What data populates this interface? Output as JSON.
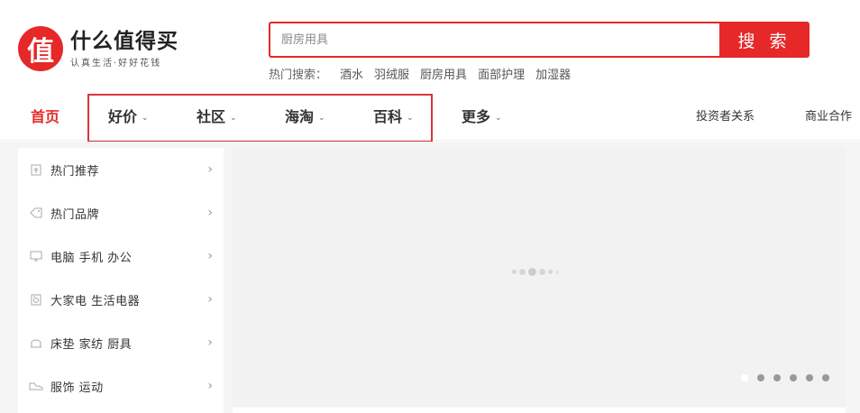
{
  "logo": {
    "badge_char": "值",
    "title": "什么值得买",
    "slogan": "认真生活·好好花钱"
  },
  "search": {
    "placeholder": "厨房用具",
    "button_label": "搜 索"
  },
  "hot_search": {
    "label": "热门搜索：",
    "items": [
      "酒水",
      "羽绒服",
      "厨房用具",
      "面部护理",
      "加湿器"
    ]
  },
  "nav": {
    "home": "首页",
    "items": [
      {
        "label": "好价"
      },
      {
        "label": "社区"
      },
      {
        "label": "海淘"
      },
      {
        "label": "百科"
      },
      {
        "label": "更多"
      }
    ],
    "right": [
      "投资者关系",
      "商业合作"
    ],
    "chevron": "⌄"
  },
  "categories": [
    {
      "label": "热门推荐",
      "icon": "hot-recommend-icon"
    },
    {
      "label": "热门品牌",
      "icon": "tag-icon"
    },
    {
      "label": "电脑  手机  办公",
      "icon": "monitor-icon"
    },
    {
      "label": "大家电  生活电器",
      "icon": "appliance-icon"
    },
    {
      "label": "床垫  家纺  厨具",
      "icon": "home-icon"
    },
    {
      "label": "服饰  运动",
      "icon": "shoe-icon"
    }
  ],
  "carousel": {
    "slide_count": 6,
    "active_index": 0
  },
  "colors": {
    "brand_red": "#e62828",
    "highlight_border": "#d9363e"
  }
}
